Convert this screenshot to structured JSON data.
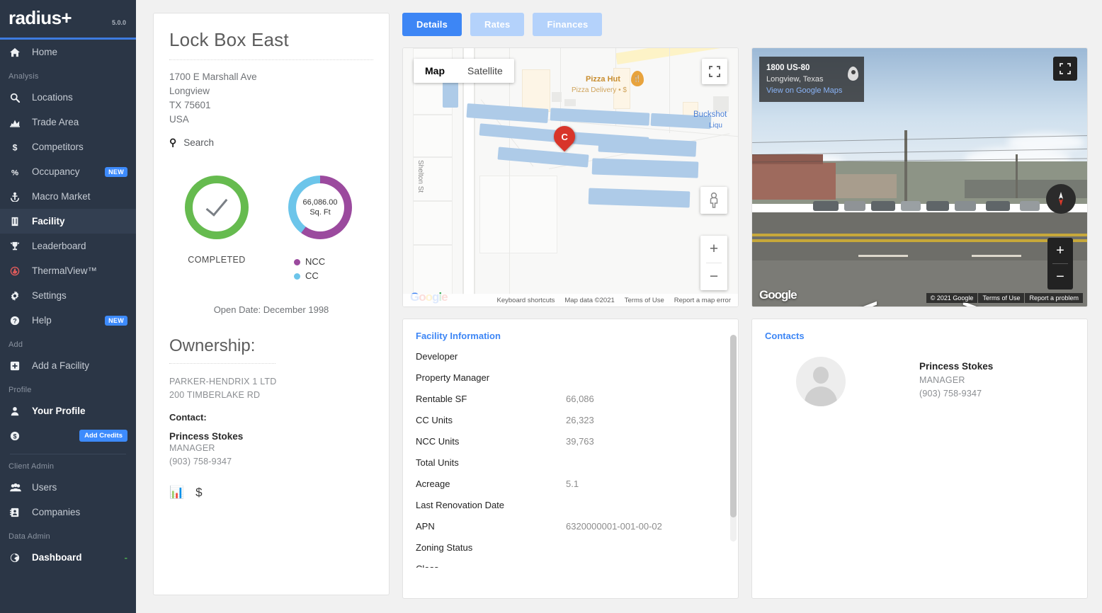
{
  "sidebar": {
    "brand": "radius+",
    "version": "5.0.0",
    "groups": [
      {
        "label": "",
        "items": [
          {
            "label": "Home",
            "icon": "home-icon",
            "badge": ""
          }
        ]
      },
      {
        "label": "Analysis",
        "items": [
          {
            "label": "Locations",
            "icon": "search-icon",
            "badge": ""
          },
          {
            "label": "Trade Area",
            "icon": "chart-area-icon",
            "badge": ""
          },
          {
            "label": "Competitors",
            "icon": "dollar-icon",
            "badge": ""
          },
          {
            "label": "Occupancy",
            "icon": "percent-icon",
            "badge": "NEW"
          },
          {
            "label": "Macro Market",
            "icon": "anchor-icon",
            "badge": ""
          },
          {
            "label": "Facility",
            "icon": "building-icon",
            "badge": "",
            "active": true
          },
          {
            "label": "Leaderboard",
            "icon": "trophy-icon",
            "badge": ""
          },
          {
            "label": "ThermalView™",
            "icon": "flame-icon",
            "badge": ""
          },
          {
            "label": "Settings",
            "icon": "gear-icon",
            "badge": ""
          },
          {
            "label": "Help",
            "icon": "question-circle-icon",
            "badge": "NEW"
          }
        ]
      },
      {
        "label": "Add",
        "items": [
          {
            "label": "Add a Facility",
            "icon": "plus-square-icon",
            "badge": ""
          }
        ]
      },
      {
        "label": "Profile",
        "items": [
          {
            "label": "Your Profile",
            "icon": "user-icon",
            "badge": ""
          },
          {
            "label": "",
            "icon": "coin-dollar-icon",
            "badge": "Add Credits"
          }
        ]
      },
      {
        "label": "Client Admin",
        "items": [
          {
            "label": "Users",
            "icon": "users-icon",
            "badge": ""
          },
          {
            "label": "Companies",
            "icon": "address-book-icon",
            "badge": ""
          }
        ]
      },
      {
        "label": "Data Admin",
        "items": [
          {
            "label": "Dashboard",
            "icon": "globe-icon",
            "badge": "-"
          }
        ]
      }
    ]
  },
  "facility": {
    "name": "Lock Box East",
    "address": [
      "1700 E Marshall Ave",
      "Longview",
      "TX 75601",
      "USA"
    ],
    "search_label": "Search",
    "status_label": "COMPLETED",
    "open_date": "Open Date: December 1998",
    "sqft_value": "66,086.00",
    "sqft_unit": "Sq. Ft",
    "legend": [
      {
        "label": "NCC",
        "color": "#9b4a9e"
      },
      {
        "label": "CC",
        "color": "#6cc5ea"
      }
    ],
    "ownership": {
      "heading": "Ownership:",
      "company": "PARKER-HENDRIX 1 LTD",
      "street": "200 TIMBERLAKE RD",
      "contact_heading": "Contact:",
      "contact_name": "Princess Stokes",
      "contact_title": "MANAGER",
      "contact_phone": "(903) 758-9347",
      "icons": [
        "report-icon",
        "dollar-icon"
      ]
    }
  },
  "chart_data": {
    "type": "pie",
    "title": "66,086.00 Sq. Ft",
    "categories": [
      "NCC",
      "CC"
    ],
    "values": [
      39763,
      26323
    ],
    "colors": [
      "#9b4a9e",
      "#6cc5ea"
    ],
    "legend_position": "right"
  },
  "tabs": [
    {
      "label": "Details",
      "active": true
    },
    {
      "label": "Rates",
      "active": false
    },
    {
      "label": "Finances",
      "active": false
    }
  ],
  "map": {
    "types": [
      "Map",
      "Satellite"
    ],
    "selected_type": "Map",
    "marker_label": "C",
    "poi_name": "Pizza Hut",
    "poi_sub": "Pizza Delivery • $",
    "poi2_name": "Buckshot",
    "poi2_sub": "Liqu",
    "street_name": "Shelton St",
    "logo": "Google",
    "footer": [
      "Keyboard shortcuts",
      "Map data ©2021",
      "Terms of Use",
      "Report a map error"
    ],
    "zoom_in": "+",
    "zoom_out": "−"
  },
  "streetview": {
    "address": "1800 US-80",
    "city": "Longview, Texas",
    "link": "View on Google Maps",
    "logo": "Google",
    "footer": [
      "© 2021 Google",
      "Terms of Use",
      "Report a problem"
    ],
    "arrow_left": "‹",
    "arrow_right": "›",
    "zoom_in": "+",
    "zoom_out": "−"
  },
  "facility_information": {
    "title": "Facility Information",
    "rows": [
      {
        "key": "Developer",
        "value": ""
      },
      {
        "key": "Property Manager",
        "value": ""
      },
      {
        "key": "Rentable SF",
        "value": "66,086"
      },
      {
        "key": "CC Units",
        "value": "26,323"
      },
      {
        "key": "NCC Units",
        "value": "39,763"
      },
      {
        "key": "Total Units",
        "value": ""
      },
      {
        "key": "Acreage",
        "value": "5.1"
      },
      {
        "key": "Last Renovation Date",
        "value": ""
      },
      {
        "key": "APN",
        "value": "6320000001-001-00-02"
      },
      {
        "key": "Zoning Status",
        "value": ""
      },
      {
        "key": "Class",
        "value": ""
      }
    ]
  },
  "contacts": {
    "title": "Contacts",
    "people": [
      {
        "name": "Princess Stokes",
        "role": "MANAGER",
        "phone": "(903) 758-9347"
      }
    ]
  }
}
